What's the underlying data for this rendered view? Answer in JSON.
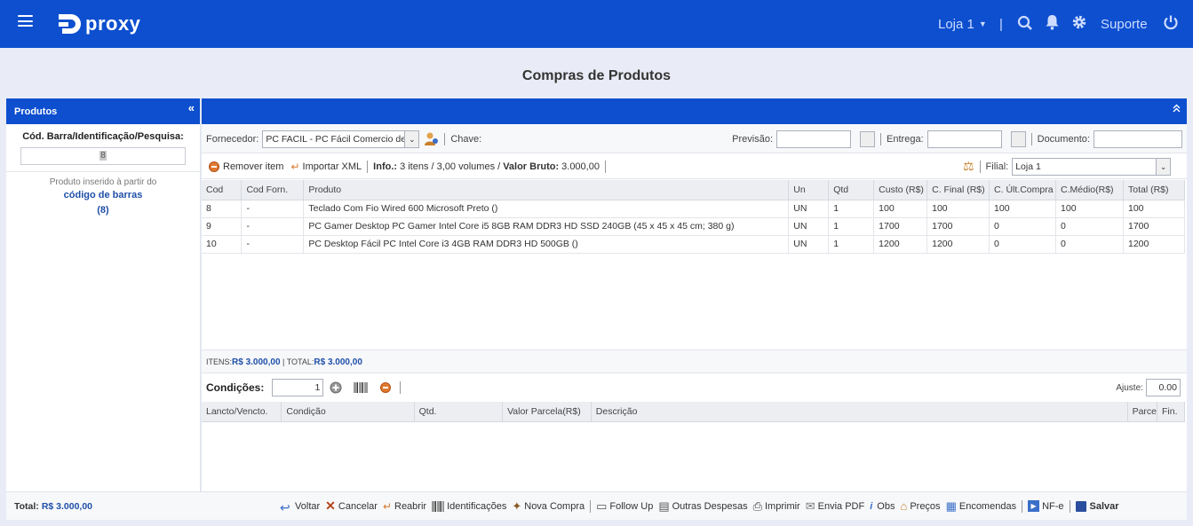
{
  "brand": {
    "name": "proxy"
  },
  "topbar": {
    "store": "Loja 1",
    "support": "Suporte"
  },
  "page": {
    "title": "Compras de Produtos"
  },
  "left_panel": {
    "header": "Produtos",
    "collapse_icon": "«",
    "search_label": "Cód. Barra/Identificação/Pesquisa:",
    "search_value": "8",
    "info_text": "Produto inserido à partir do",
    "info_link": "código de barras",
    "info_code": "(8)"
  },
  "form": {
    "supplier_label": "Fornecedor:",
    "supplier_value": "PC FACIL - PC Fácil Comercio de",
    "key_label": "Chave:",
    "forecast_label": "Previsão:",
    "delivery_label": "Entrega:",
    "document_label": "Documento:",
    "remove_item": "Remover item",
    "import_xml": "Importar XML",
    "info_label": "Info.:",
    "info_value": "3 itens / 3,00 volumes /",
    "gross_label": "Valor Bruto:",
    "gross_value": "3.000,00",
    "branch_label": "Filial:",
    "branch_value": "Loja 1"
  },
  "products_table": {
    "columns": [
      "Cod",
      "Cod Forn.",
      "Produto",
      "Un",
      "Qtd",
      "Custo (R$)",
      "C. Final (R$)",
      "C. Últ.Compra",
      "C.Médio(R$)",
      "Total (R$)"
    ],
    "rows": [
      [
        "8",
        "-",
        "Teclado Com Fio Wired 600 Microsoft Preto ()",
        "UN",
        "1",
        "100",
        "100",
        "100",
        "100",
        "100"
      ],
      [
        "9",
        "-",
        "PC Gamer Desktop PC Gamer Intel Core i5 8GB RAM DDR3 HD SSD 240GB (45 x 45 x 45 cm; 380 g)",
        "UN",
        "1",
        "1700",
        "1700",
        "0",
        "0",
        "1700"
      ],
      [
        "10",
        "-",
        "PC Desktop Fácil PC Intel Core i3 4GB RAM DDR3 HD 500GB ()",
        "UN",
        "1",
        "1200",
        "1200",
        "0",
        "0",
        "1200"
      ]
    ]
  },
  "totals": {
    "items_label": "ITENS:",
    "items_value": "R$ 3.000,00",
    "total_label": "TOTAL:",
    "total_value": "R$ 3.000,00"
  },
  "conditions": {
    "label": "Condições:",
    "count_value": "1",
    "adjust_label": "Ajuste:",
    "adjust_value": "0.00",
    "columns": [
      "Lancto/Vencto.",
      "Condição",
      "Qtd.",
      "Valor Parcela(R$)",
      "Descrição",
      "Parce",
      "Fin."
    ]
  },
  "footer": {
    "total_label": "Total:",
    "total_value": "R$ 3.000,00",
    "buttons": [
      "Voltar",
      "Cancelar",
      "Reabrir",
      "Identificações",
      "Nova Compra",
      "Follow Up",
      "Outras Despesas",
      "Imprimir",
      "Envia PDF",
      "Obs",
      "Preços",
      "Encomendas",
      "NF-e",
      "Salvar"
    ]
  },
  "colors": {
    "primary": "#0d4fcf",
    "link": "#1f4fa8",
    "background": "#e9ecf6"
  }
}
